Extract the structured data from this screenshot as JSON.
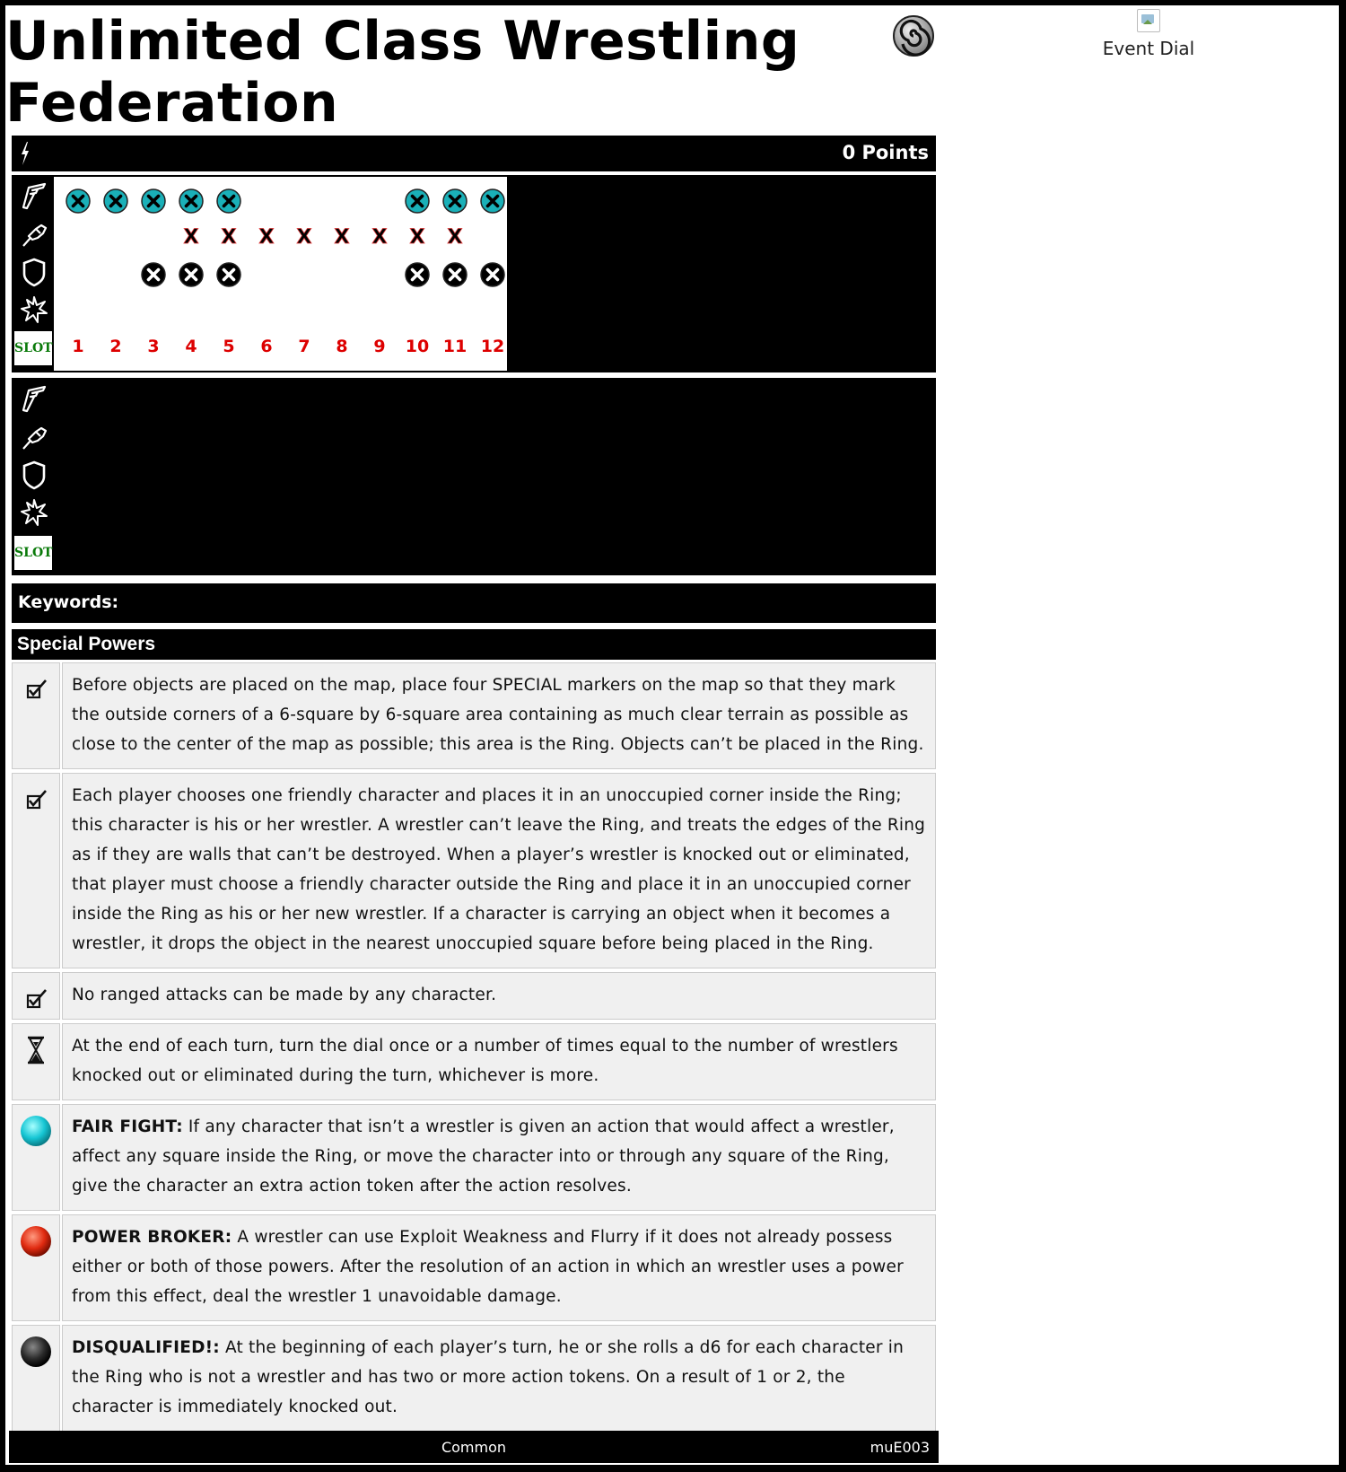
{
  "title": "Unlimited Class Wrestling Federation",
  "event_dial_label": "Event Dial",
  "points_text": "0 Points",
  "slot_label": "SLOT",
  "keywords_label": "Keywords:",
  "special_powers_label": "Special Powers",
  "dial": {
    "columns": [
      "1",
      "2",
      "3",
      "4",
      "5",
      "6",
      "7",
      "8",
      "9",
      "10",
      "11",
      "12"
    ],
    "speed_marks": [
      1,
      2,
      3,
      4,
      5,
      10,
      11,
      12
    ],
    "attack_marks": [
      4,
      5,
      6,
      7,
      8,
      9,
      10,
      11
    ],
    "defense_marks": [
      3,
      4,
      5,
      10,
      11,
      12
    ],
    "damage_marks": [],
    "colors": {
      "speed": "#1ab0b8",
      "defense": "#000000",
      "attack_x": "#000000",
      "slot_text": "#0a7a0a",
      "number": "#dd0000"
    }
  },
  "powers": [
    {
      "icon": "checkbox-icon",
      "name": "",
      "text": "Before objects are placed on the map, place four SPECIAL markers on the map so that they mark the outside corners of a 6-square by 6-square area containing as much clear terrain as possible as close to the center of the map as possible; this area is the Ring. Objects can’t be placed in the Ring."
    },
    {
      "icon": "checkbox-icon",
      "name": "",
      "text": "Each player chooses one friendly character and places it in an unoccupied corner inside the Ring; this character is his or her wrestler. A wrestler can’t leave the Ring, and treats the edges of the Ring as if they are walls that can’t be destroyed. When a player’s wrestler is knocked out or eliminated, that player must choose a friendly character outside the Ring and place it in an unoccupied corner inside the Ring as his or her new wrestler. If a character is carrying an object when it becomes a wrestler, it drops the object in the nearest unoccupied square before being placed in the Ring."
    },
    {
      "icon": "checkbox-icon",
      "name": "",
      "text": "No ranged attacks can be made by any character."
    },
    {
      "icon": "hourglass-icon",
      "name": "",
      "text": "At the end of each turn, turn the dial once or a number of times equal to the number of wrestlers knocked out or eliminated during the turn, whichever is more."
    },
    {
      "icon": "cyan-orb-icon",
      "name": "FAIR FIGHT:",
      "text": " If any character that isn’t a wrestler is given an action that would affect a wrestler, affect any square inside the Ring, or move the character into or through any square of the Ring, give the character an extra action token after the action resolves."
    },
    {
      "icon": "red-orb-icon",
      "name": "POWER BROKER:",
      "text": " A wrestler can use Exploit Weakness and Flurry if it does not already possess either or both of those powers. After the resolution of an action in which an wrestler uses a power from this effect, deal the wrestler 1 unavoidable damage."
    },
    {
      "icon": "black-orb-icon",
      "name": "DISQUALIFIED!:",
      "text": " At the beginning of each player’s turn, he or she rolls a d6 for each character in the Ring who is not a wrestler and has two or more action tokens. On a result of 1 or 2, the character is immediately knocked out."
    }
  ],
  "footer": {
    "rarity": "Common",
    "code": "muE003"
  }
}
